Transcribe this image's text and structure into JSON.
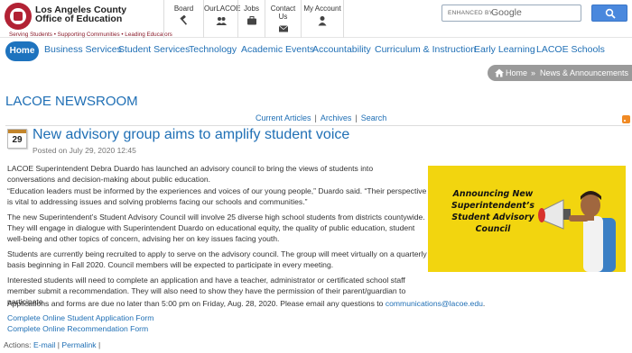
{
  "header": {
    "org_line1": "Los Angeles County",
    "org_line2": "Office of Education",
    "tagline": "Serving Students • Supporting Communities • Leading Educators",
    "utility": [
      {
        "label": "Board",
        "icon": "gavel-icon"
      },
      {
        "label": "OurLACOE",
        "icon": "users-icon"
      },
      {
        "label": "Jobs",
        "icon": "briefcase-icon"
      },
      {
        "label": "Contact Us",
        "icon": "envelope-icon"
      },
      {
        "label": "My Account",
        "icon": "user-icon"
      }
    ],
    "search": {
      "enhanced_by": "ENHANCED BY",
      "engine": "Google"
    }
  },
  "nav": {
    "items": [
      "Home",
      "Business Services",
      "Student Services",
      "Technology",
      "Academic Events",
      "Accountability",
      "Curriculum & Instruction",
      "Early Learning",
      "LACOE Schools"
    ]
  },
  "breadcrumb": {
    "home": "Home",
    "separator": "»",
    "current": "News & Announcements"
  },
  "newsroom_title": "LACOE NEWSROOM",
  "links": {
    "current": "Current Articles",
    "archives": "Archives",
    "search": "Search"
  },
  "article": {
    "day": "29",
    "title": "New advisory group aims to amplify student voice",
    "posted": "Posted on July 29, 2020 12:45",
    "paragraphs": [
      "LACOE Superintendent Debra Duardo has launched an advisory council to bring the views of students into conversations and decision-making about public education.",
      "“Education leaders must be informed by the experiences and voices of our young people,” Duardo said. “Their perspective is vital to addressing issues and solving problems facing our schools and communities.”",
      "The new Superintendent’s Student Advisory Council will involve 25 diverse high school students from districts countywide. They will engage in dialogue with Superintendent Duardo on educational equity, the quality of public education, student well-being and other topics of concern, advising her on key issues facing youth.",
      "Students are currently being recruited to apply to serve on the advisory council. The group will meet virtually on a quarterly basis beginning in Fall 2020. Council members will be expected to participate in every meeting.",
      "Interested students will need to complete an application and have a teacher, administrator or certificated school staff member submit a recommendation. They will also need to show they have the permission of their parent/guardian to participate."
    ],
    "deadline_text": "Applications and forms are due no later than 5:00 pm on Friday, Aug. 28, 2020. Please email any questions to ",
    "email": "communications@lacoe.edu",
    "deadline_end": ".",
    "form_links": [
      "Complete Online Student Application Form",
      "Complete Online Recommendation Form"
    ],
    "actions_label": "Actions:",
    "actions": [
      "E-mail",
      "Permalink"
    ]
  },
  "promo": {
    "text": "Announcing New Superintendent’s Student Advisory Council",
    "bg_color": "#f2d50f"
  },
  "colors": {
    "link": "#1f6fb5",
    "nav_active": "#1e73be",
    "breadcrumb": "#9a9a9a"
  }
}
